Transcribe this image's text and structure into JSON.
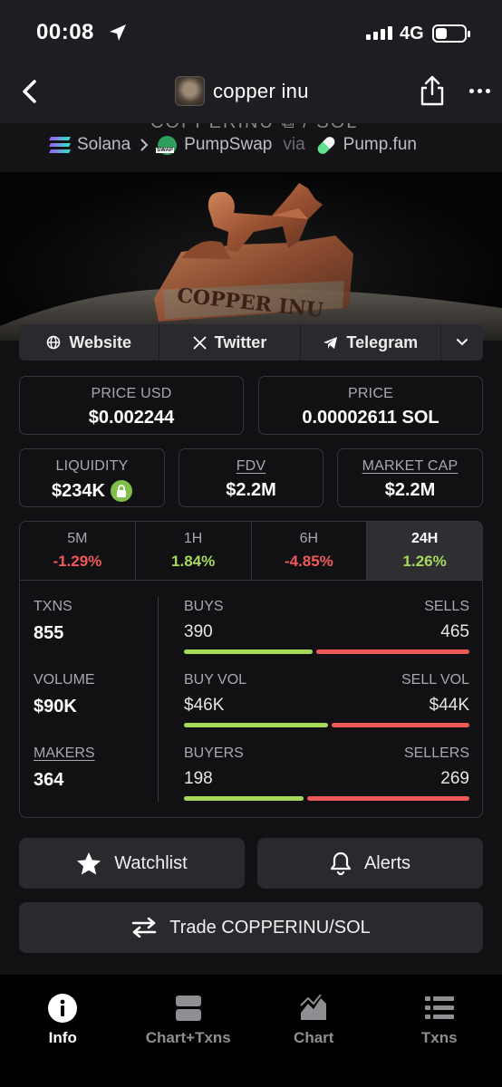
{
  "status_bar": {
    "time": "00:08",
    "network": "4G"
  },
  "header": {
    "title": "copper inu"
  },
  "pair_line": {
    "cut_off_text": "COPPERINU ⧉ / SOL",
    "chain": "Solana",
    "dex": "PumpSwap",
    "via_label": "via",
    "launchpad": "Pump.fun"
  },
  "links": {
    "website": "Website",
    "twitter": "Twitter",
    "telegram": "Telegram"
  },
  "price_usd": {
    "label": "PRICE USD",
    "value": "$0.002244"
  },
  "price_native": {
    "label": "PRICE",
    "value": "0.00002611 SOL"
  },
  "liquidity": {
    "label": "LIQUIDITY",
    "value": "$234K"
  },
  "fdv": {
    "label": "FDV",
    "value": "$2.2M"
  },
  "market_cap": {
    "label": "MARKET CAP",
    "value": "$2.2M"
  },
  "timeframes": [
    {
      "period": "5M",
      "change": "-1.29%",
      "direction": "down"
    },
    {
      "period": "1H",
      "change": "1.84%",
      "direction": "up"
    },
    {
      "period": "6H",
      "change": "-4.85%",
      "direction": "down"
    },
    {
      "period": "24H",
      "change": "1.26%",
      "direction": "up",
      "selected": true
    }
  ],
  "stats": {
    "txns": {
      "label": "TXNS",
      "value": "855"
    },
    "volume": {
      "label": "VOLUME",
      "value": "$90K"
    },
    "makers": {
      "label": "MAKERS",
      "value": "364"
    },
    "buys": {
      "label": "BUYS",
      "value": "390"
    },
    "sells": {
      "label": "SELLS",
      "value": "465"
    },
    "buy_vol": {
      "label": "BUY VOL",
      "value": "$46K"
    },
    "sell_vol": {
      "label": "SELL VOL",
      "value": "$44K"
    },
    "buyers": {
      "label": "BUYERS",
      "value": "198"
    },
    "sellers": {
      "label": "SELLERS",
      "value": "269"
    }
  },
  "ratios": {
    "buys_share": 0.456,
    "buy_vol_share": 0.511,
    "buyers_share": 0.424
  },
  "actions": {
    "watchlist": "Watchlist",
    "alerts": "Alerts",
    "trade": "Trade COPPERINU/SOL"
  },
  "bottom_nav": [
    {
      "label": "Info",
      "icon": "info-icon",
      "active": true
    },
    {
      "label": "Chart+Txns",
      "icon": "chart-txns-icon"
    },
    {
      "label": "Chart",
      "icon": "chart-icon"
    },
    {
      "label": "Txns",
      "icon": "list-icon"
    }
  ],
  "colors": {
    "positive": "#a6d95a",
    "negative": "#f0595a",
    "background": "#111114"
  }
}
